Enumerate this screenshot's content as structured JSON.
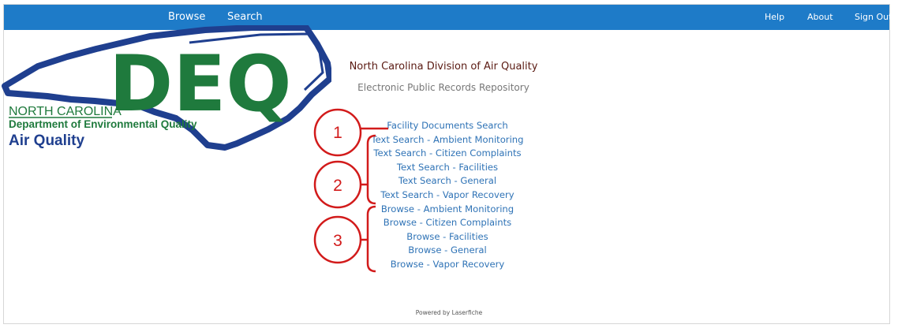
{
  "nav": {
    "browse": "Browse",
    "search": "Search",
    "help": "Help",
    "about": "About",
    "signout": "Sign Out"
  },
  "logo": {
    "acronym": "DEQ",
    "line1": "NORTH CAROLINA",
    "line2": "Department of Environmental Quality",
    "line3": "Air Quality",
    "colors": {
      "green": "#1f7a3d",
      "blue": "#1f3f8f"
    }
  },
  "header": {
    "title": "North Carolina Division of Air Quality",
    "subtitle": "Electronic Public Records Repository"
  },
  "links": [
    "Facility Documents Search",
    "Text Search - Ambient Monitoring",
    "Text Search - Citizen Complaints",
    "Text Search - Facilities",
    "Text Search - General",
    "Text Search - Vapor Recovery",
    "Browse - Ambient Monitoring",
    "Browse - Citizen Complaints",
    "Browse - Facilities",
    "Browse - General",
    "Browse - Vapor Recovery"
  ],
  "annotations": [
    "1",
    "2",
    "3"
  ],
  "annotation_color": "#d21b1b",
  "footer": "Powered by Laserfiche"
}
